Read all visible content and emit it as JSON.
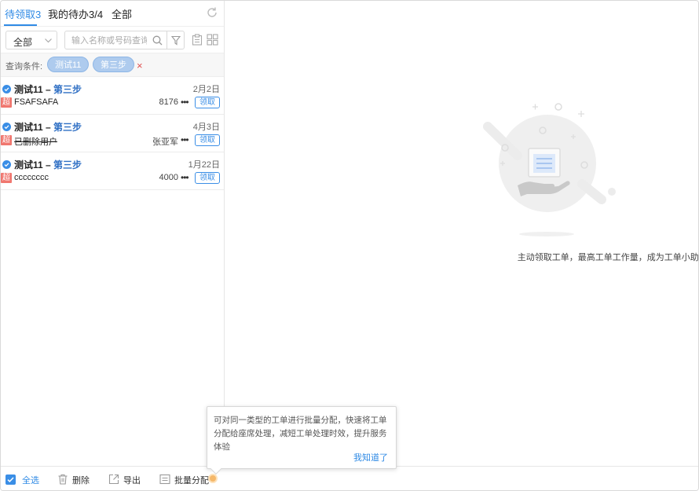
{
  "tabs": [
    {
      "label": "待领取3",
      "active": true
    },
    {
      "label": "我的待办3/4",
      "active": false
    },
    {
      "label": "全部",
      "active": false
    }
  ],
  "toolbar": {
    "select_value": "全部",
    "search_placeholder": "输入名称或号码查询"
  },
  "criteria": {
    "label": "查询条件:",
    "chips": [
      "测试11",
      "第三步"
    ],
    "clear": "×"
  },
  "items": [
    {
      "title": "测试11",
      "dash": " – ",
      "step": "第三步",
      "date": "2月2日",
      "badge": "超",
      "name": "FSAFSAFA",
      "struck": false,
      "owner": "8176",
      "dots": "•••",
      "claim": "领取"
    },
    {
      "title": "测试11",
      "dash": " – ",
      "step": "第三步",
      "date": "4月3日",
      "badge": "超",
      "name": "已删除用户",
      "struck": true,
      "owner": "张亚军",
      "dots": "•••",
      "claim": "领取"
    },
    {
      "title": "测试11",
      "dash": " – ",
      "step": "第三步",
      "date": "1月22日",
      "badge": "超",
      "name": "cccccccc",
      "struck": false,
      "owner": "4000",
      "dots": "•••",
      "claim": "领取"
    }
  ],
  "empty": {
    "message": "主动领取工单，最高工单工作量，成为工单小助手~"
  },
  "bottom": {
    "select_all": "全选",
    "delete": "删除",
    "export": "导出",
    "batch_assign": "批量分配"
  },
  "tooltip": {
    "text": "可对同一类型的工单进行批量分配，快速将工单分配给座席处理，减短工单处理时效，提升服务体验",
    "ok": "我知道了"
  },
  "colors": {
    "accent": "#2f8ae5",
    "chip_bg": "#aecbee",
    "badge": "#f0776f"
  }
}
